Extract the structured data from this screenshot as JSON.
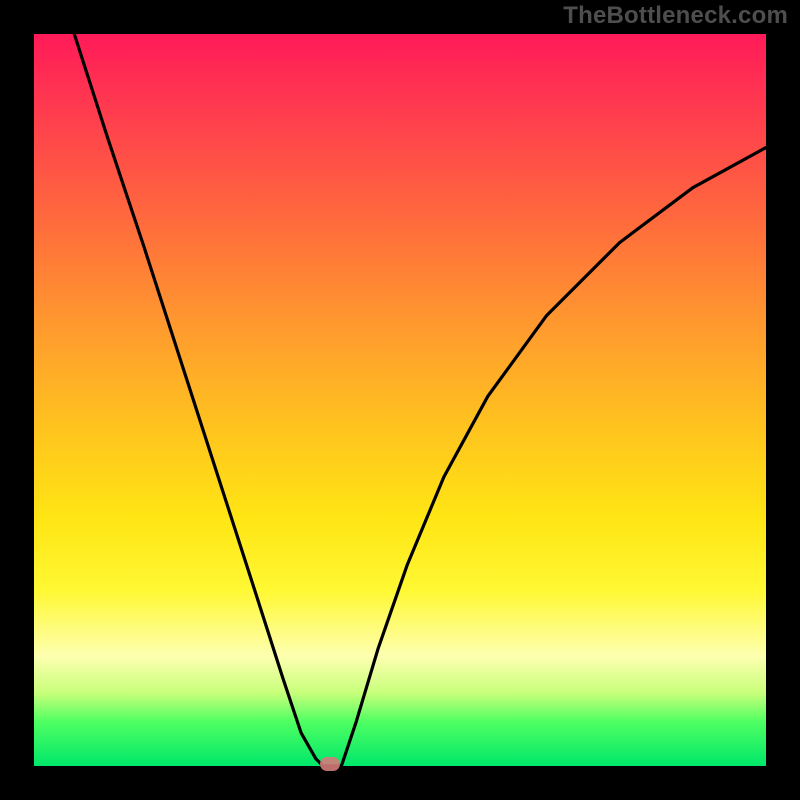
{
  "watermark": "TheBottleneck.com",
  "chart_data": {
    "type": "line",
    "title": "",
    "xlabel": "",
    "ylabel": "",
    "xlim": [
      0,
      1
    ],
    "ylim": [
      0,
      1
    ],
    "grid": false,
    "legend": false,
    "series": [
      {
        "name": "left-branch",
        "x": [
          0.055,
          0.1,
          0.15,
          0.2,
          0.25,
          0.3,
          0.34,
          0.365,
          0.385,
          0.395
        ],
        "y": [
          1.0,
          0.86,
          0.71,
          0.555,
          0.4,
          0.245,
          0.12,
          0.045,
          0.01,
          0.0
        ]
      },
      {
        "name": "vertex-flat",
        "x": [
          0.395,
          0.42
        ],
        "y": [
          0.0,
          0.0
        ]
      },
      {
        "name": "right-branch",
        "x": [
          0.42,
          0.44,
          0.47,
          0.51,
          0.56,
          0.62,
          0.7,
          0.8,
          0.9,
          1.0
        ],
        "y": [
          0.0,
          0.06,
          0.16,
          0.275,
          0.395,
          0.505,
          0.615,
          0.715,
          0.79,
          0.845
        ]
      }
    ],
    "gradient_stops": [
      {
        "pos": 0.0,
        "color": "#ff1a58"
      },
      {
        "pos": 0.26,
        "color": "#ff6c3c"
      },
      {
        "pos": 0.54,
        "color": "#ffc41e"
      },
      {
        "pos": 0.76,
        "color": "#fff833"
      },
      {
        "pos": 0.9,
        "color": "#c8ff7a"
      },
      {
        "pos": 1.0,
        "color": "#00e76a"
      }
    ],
    "marker": {
      "x": 0.405,
      "y": 0.003,
      "color": "#d47a7a"
    }
  }
}
